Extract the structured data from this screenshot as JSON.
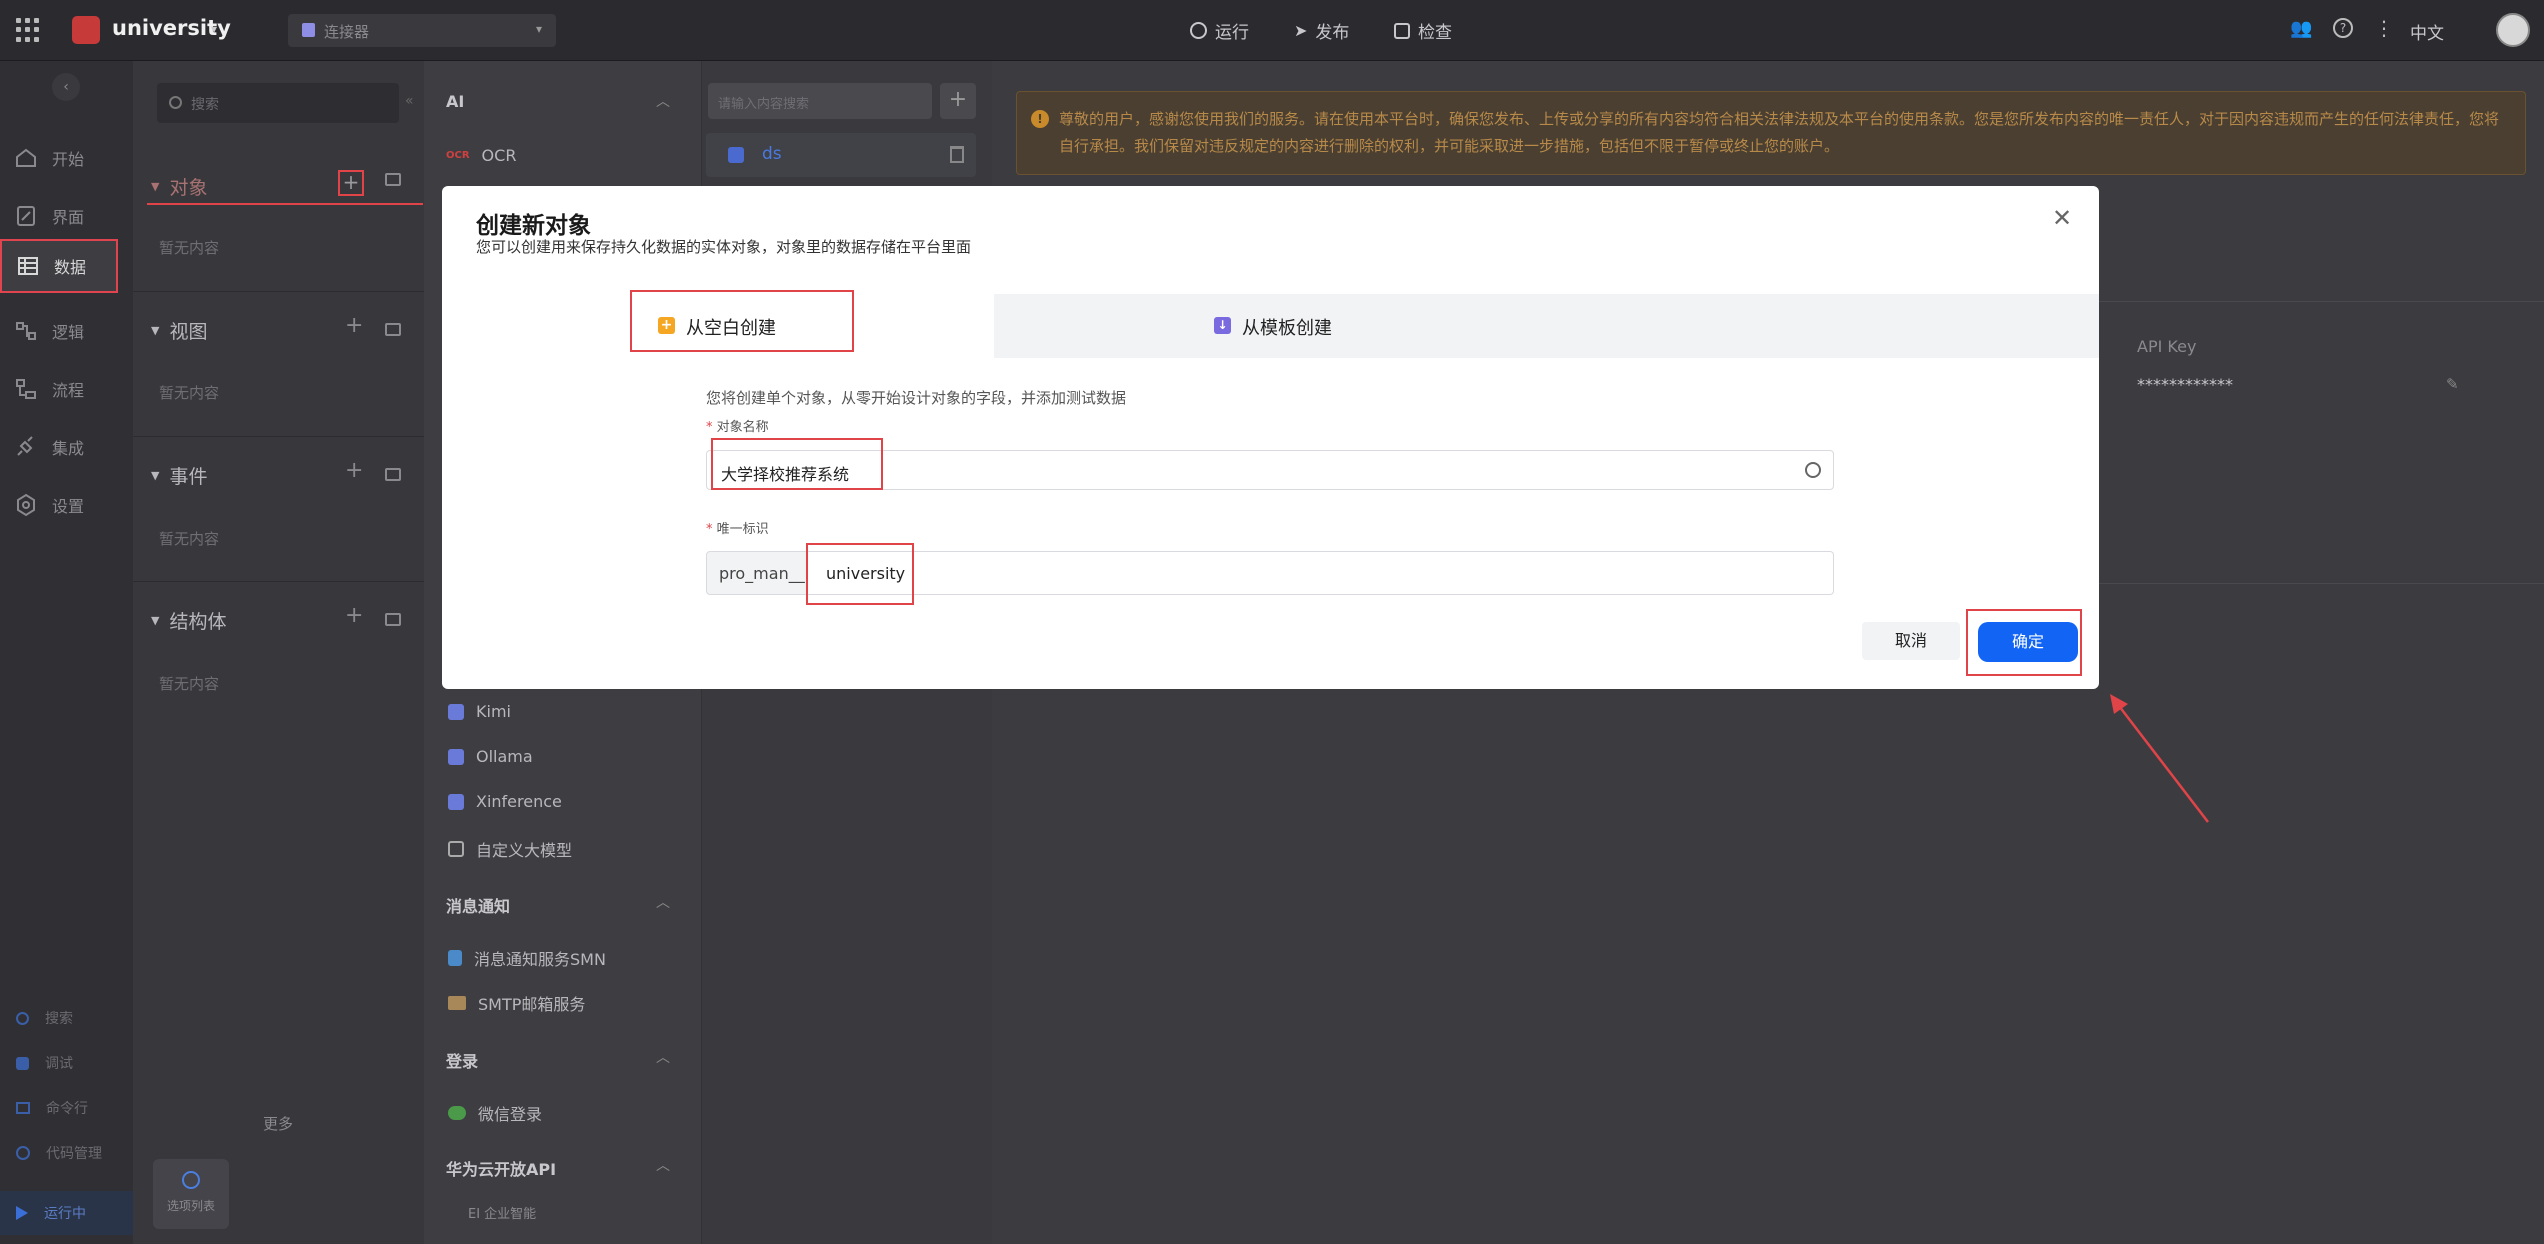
{
  "topbar": {
    "app_name": "university",
    "connector_label": "连接器",
    "run_label": "运行",
    "publish_label": "发布",
    "check_label": "检查",
    "language_label": "中文"
  },
  "rail": {
    "items": [
      {
        "label": "开始",
        "icon": "home-icon"
      },
      {
        "label": "界面",
        "icon": "page-icon"
      },
      {
        "label": "数据",
        "icon": "table-icon"
      },
      {
        "label": "逻辑",
        "icon": "logic-icon"
      },
      {
        "label": "流程",
        "icon": "flow-icon"
      },
      {
        "label": "集成",
        "icon": "plug-icon"
      },
      {
        "label": "设置",
        "icon": "settings-icon"
      }
    ],
    "bottom": [
      {
        "label": "搜索",
        "icon": "search-icon"
      },
      {
        "label": "调试",
        "icon": "debug-icon"
      },
      {
        "label": "命令行",
        "icon": "terminal-icon"
      },
      {
        "label": "代码管理",
        "icon": "code-icon"
      },
      {
        "label": "运行中",
        "icon": "run-icon"
      }
    ]
  },
  "panel": {
    "search_placeholder": "搜索",
    "sections": [
      {
        "title": "对象",
        "empty": "暂无内容"
      },
      {
        "title": "视图",
        "empty": "暂无内容"
      },
      {
        "title": "事件",
        "empty": "暂无内容"
      },
      {
        "title": "结构体",
        "empty": "暂无内容"
      }
    ],
    "more_label": "更多",
    "options_label": "选项列表"
  },
  "connectors": {
    "head_ai": "AI",
    "ocr_label": "OCR",
    "items": [
      "Kimi",
      "Ollama",
      "Xinference",
      "自定义大模型"
    ],
    "head_notify": "消息通知",
    "notify_items": [
      "消息通知服务SMN",
      "SMTP邮箱服务"
    ],
    "head_login": "登录",
    "login_items": [
      "微信登录"
    ],
    "head_hw": "华为云开放API",
    "hw_items": [
      "EI 企业智能"
    ]
  },
  "list": {
    "search_placeholder": "请输入内容搜索",
    "item_label": "ds"
  },
  "main": {
    "notice": "尊敬的用户，感谢您使用我们的服务。请在使用本平台时，确保您发布、上传或分享的所有内容均符合相关法律法规及本平台的使用条款。您是您所发布内容的唯一责任人，对于因内容违规而产生的任何法律责任，您将自行承担。我们保留对违反规定的内容进行删除的权利，并可能采取进一步措施，包括但不限于暂停或终止您的账户。",
    "api_key_label": "API Key",
    "api_key_value": "************"
  },
  "modal": {
    "title": "创建新对象",
    "subtitle": "您可以创建用来保存持久化数据的实体对象，对象里的数据存储在平台里面",
    "tab_blank": "从空白创建",
    "tab_template": "从模板创建",
    "desc": "您将创建单个对象，从零开始设计对象的字段，并添加测试数据",
    "name_label": "对象名称",
    "name_value": "大学择校推荐系统",
    "id_label": "唯一标识",
    "id_prefix": "pro_man__",
    "id_value": "university",
    "cancel_label": "取消",
    "confirm_label": "确定",
    "accent": "#1264f5",
    "highlight": "#e04448"
  }
}
